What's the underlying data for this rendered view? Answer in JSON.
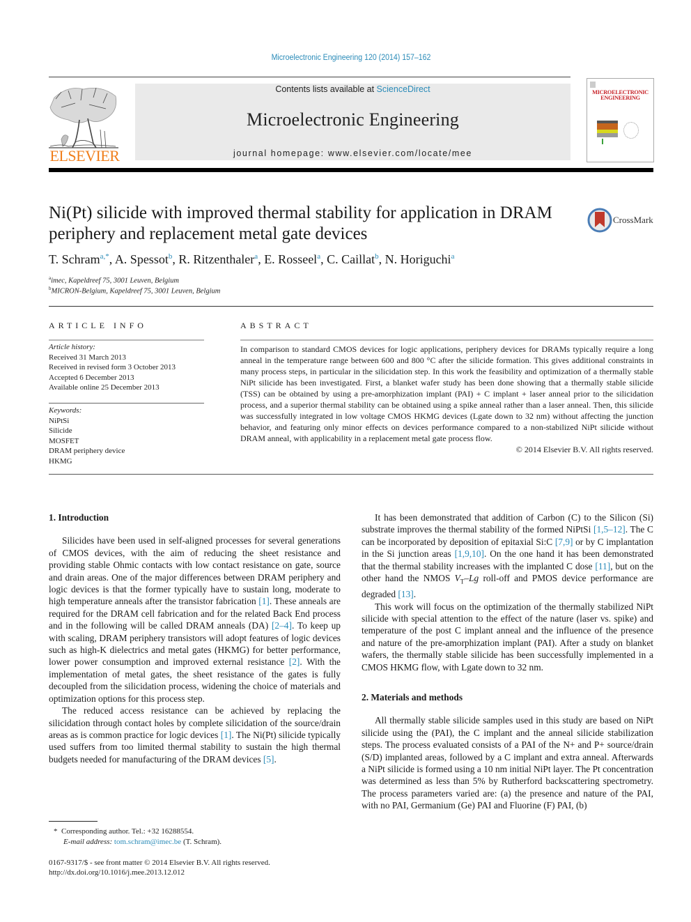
{
  "journal_citation": "Microelectronic Engineering 120 (2014) 157–162",
  "header": {
    "publisher_word": "ELSEVIER",
    "contents_prefix": "Contents lists available at ",
    "contents_link": "ScienceDirect",
    "journal_title": "Microelectronic Engineering",
    "homepage_label": "journal homepage: www.elsevier.com/locate/mee",
    "cover_title_line1": "MICROELECTRONIC",
    "cover_title_line2": "ENGINEERING",
    "colors": {
      "publisher_orange": "#f07e1b",
      "link_blue": "#2a8bb8",
      "banner_grey": "#eaeaea"
    }
  },
  "article": {
    "title_line1": "Ni(Pt) silicide with improved thermal stability for application in DRAM",
    "title_line2": "periphery and replacement metal gate devices",
    "crossmark_label": "CrossMark",
    "authors": [
      {
        "name": "T. Schram",
        "sup": "a,*"
      },
      {
        "name": "A. Spessot",
        "sup": "b"
      },
      {
        "name": "R. Ritzenthaler",
        "sup": "a"
      },
      {
        "name": "E. Rosseel",
        "sup": "a"
      },
      {
        "name": "C. Caillat",
        "sup": "b"
      },
      {
        "name": "N. Horiguchi",
        "sup": "a"
      }
    ],
    "affiliations": [
      {
        "mark": "a",
        "text": "imec, Kapeldreef 75, 3001 Leuven, Belgium"
      },
      {
        "mark": "b",
        "text": "MICRON-Belgium, Kapeldreef 75, 3001 Leuven, Belgium"
      }
    ]
  },
  "article_info": {
    "heading": "ARTICLE INFO",
    "history_label": "Article history:",
    "history": [
      "Received 31 March 2013",
      "Received in revised form 3 October 2013",
      "Accepted 6 December 2013",
      "Available online 25 December 2013"
    ],
    "keywords_label": "Keywords:",
    "keywords": [
      "NiPtSi",
      "Silicide",
      "MOSFET",
      "DRAM periphery device",
      "HKMG"
    ]
  },
  "abstract": {
    "heading": "ABSTRACT",
    "text": "In comparison to standard CMOS devices for logic applications, periphery devices for DRAMs typically require a long anneal in the temperature range between 600 and 800 °C after the silicide formation. This gives additional constraints in many process steps, in particular in the silicidation step. In this work the feasibility and optimization of a thermally stable NiPt silicide has been investigated. First, a blanket wafer study has been done showing that a thermally stable silicide (TSS) can be obtained by using a pre-amorphization implant (PAI) + C implant + laser anneal prior to the silicidation process, and a superior thermal stability can be obtained using a spike anneal rather than a laser anneal. Then, this silicide was successfully integrated in low voltage CMOS HKMG devices (Lgate down to 32 nm) without affecting the junction behavior, and featuring only minor effects on devices performance compared to a non-stabilized NiPt silicide without DRAM anneal, with applicability in a replacement metal gate process flow.",
    "copyright": "© 2014 Elsevier B.V. All rights reserved."
  },
  "left_column": {
    "section1_heading": "1. Introduction",
    "p1": [
      {
        "t": "Silicides have been used in self-aligned processes for several generations of CMOS devices, with the aim of reducing the sheet resistance and providing stable Ohmic contacts with low contact resistance on gate, source and drain areas. One of the major differences between DRAM periphery and logic devices is that the former typically have to sustain long, moderate to high temperature anneals after the transistor fabrication "
      },
      {
        "ref": "[1]"
      },
      {
        "t": ". These anneals are required for the DRAM cell fabrication and for the related Back End process and in the following will be called DRAM anneals (DA) "
      },
      {
        "ref": "[2–4]"
      },
      {
        "t": ". To keep up with scaling, DRAM periphery transistors will adopt features of logic devices such as high-K dielectrics and metal gates (HKMG) for better performance, lower power consumption and improved external resistance "
      },
      {
        "ref": "[2]"
      },
      {
        "t": ". With the implementation of metal gates, the sheet resistance of the gates is fully decoupled from the silicidation process, widening the choice of materials and optimization options for this process step."
      }
    ],
    "p2": [
      {
        "t": "The reduced access resistance can be achieved by replacing the silicidation through contact holes by complete silicidation of the source/drain areas as is common practice for logic devices "
      },
      {
        "ref": "[1]"
      },
      {
        "t": ". The Ni(Pt) silicide typically used suffers from too limited thermal stability to sustain the high thermal budgets needed for manufacturing of the DRAM devices "
      },
      {
        "ref": "[5]"
      },
      {
        "t": "."
      }
    ]
  },
  "right_column": {
    "p1": [
      {
        "t": "It has been demonstrated that addition of Carbon (C) to the Silicon (Si) substrate improves the thermal stability of the formed NiPtSi "
      },
      {
        "ref": "[1,5–12]"
      },
      {
        "t": ". The C can be incorporated by deposition of epitaxial Si:C "
      },
      {
        "ref": "[7,9]"
      },
      {
        "t": " or by C implantation in the Si junction areas "
      },
      {
        "ref": "[1,9,10]"
      },
      {
        "t": ". On the one hand it has been demonstrated that the thermal stability increases with the implanted C dose "
      },
      {
        "ref": "[11]"
      },
      {
        "t": ", but on the other hand the NMOS "
      },
      {
        "it": "V"
      },
      {
        "sub": "T"
      },
      {
        "it": "–Lg"
      },
      {
        "t": " roll-off and PMOS device performance are degraded "
      },
      {
        "ref": "[13]"
      },
      {
        "t": "."
      }
    ],
    "p2": "This work will focus on the optimization of the thermally stabilized NiPt silicide with special attention to the effect of the nature (laser vs. spike) and temperature of the post C implant anneal and the influence of the presence and nature of the pre-amorphization implant (PAI). After a study on blanket wafers, the thermally stable silicide has been successfully implemented in a CMOS HKMG flow, with Lgate down to 32 nm.",
    "section2_heading": "2. Materials and methods",
    "p3": "All thermally stable silicide samples used in this study are based on NiPt silicide using the (PAI), the C implant and the anneal silicide stabilization steps. The process evaluated consists of a PAI of the N+ and P+ source/drain (S/D) implanted areas, followed by a C implant and extra anneal. Afterwards a NiPt silicide is formed using a 10 nm initial NiPt layer. The Pt concentration was determined as less than 5% by Rutherford backscattering spectrometry. The process parameters varied are: (a) the presence and nature of the PAI, with no PAI, Germanium (Ge) PAI and Fluorine (F) PAI, (b)"
  },
  "footnotes": {
    "corresponding_mark": "*",
    "corresponding": "Corresponding author. Tel.: +32 16288554.",
    "email_label": "E-mail address: ",
    "email": "tom.schram@imec.be",
    "email_suffix": " (T. Schram).",
    "issn_line": "0167-9317/$ - see front matter © 2014 Elsevier B.V. All rights reserved.",
    "doi": "http://dx.doi.org/10.1016/j.mee.2013.12.012"
  }
}
